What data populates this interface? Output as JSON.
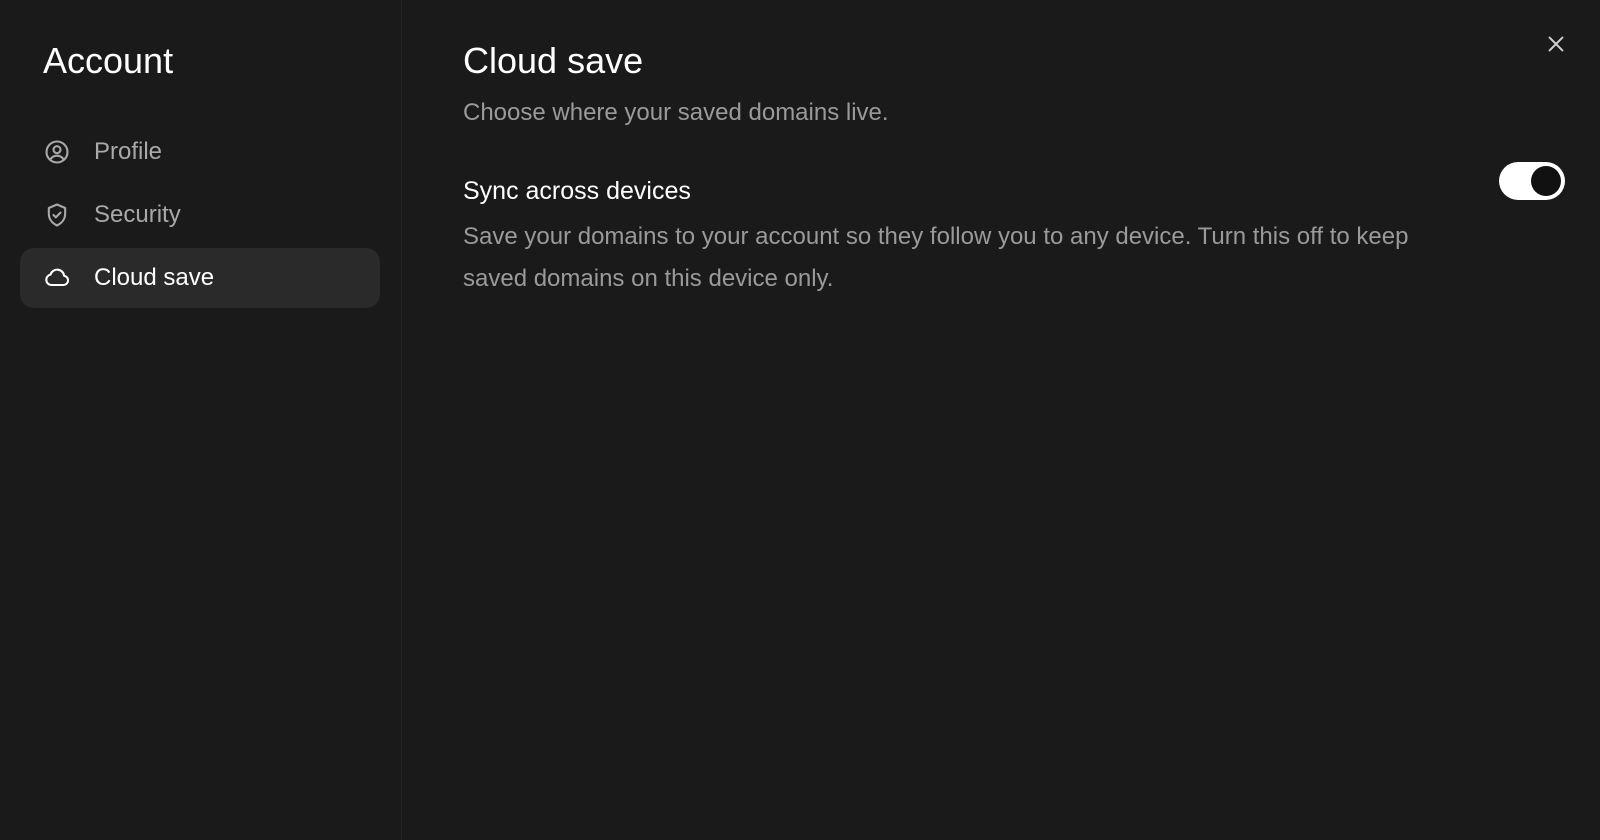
{
  "sidebar": {
    "title": "Account",
    "items": [
      {
        "label": "Profile",
        "icon": "user-circle-icon",
        "active": false
      },
      {
        "label": "Security",
        "icon": "shield-check-icon",
        "active": false
      },
      {
        "label": "Cloud save",
        "icon": "cloud-icon",
        "active": true
      }
    ]
  },
  "main": {
    "title": "Cloud save",
    "subtitle": "Choose where your saved domains live.",
    "settings": [
      {
        "title": "Sync across devices",
        "description": "Save your domains to your account so they follow you to any device. Turn this off to keep saved domains on this device only.",
        "enabled": true
      }
    ]
  },
  "icons": {
    "close": "close-icon"
  },
  "colors": {
    "background": "#1a1a1a",
    "active_item": "#2a2a2a",
    "muted_text": "#9a9a9a",
    "toggle_on": "#ffffff"
  }
}
